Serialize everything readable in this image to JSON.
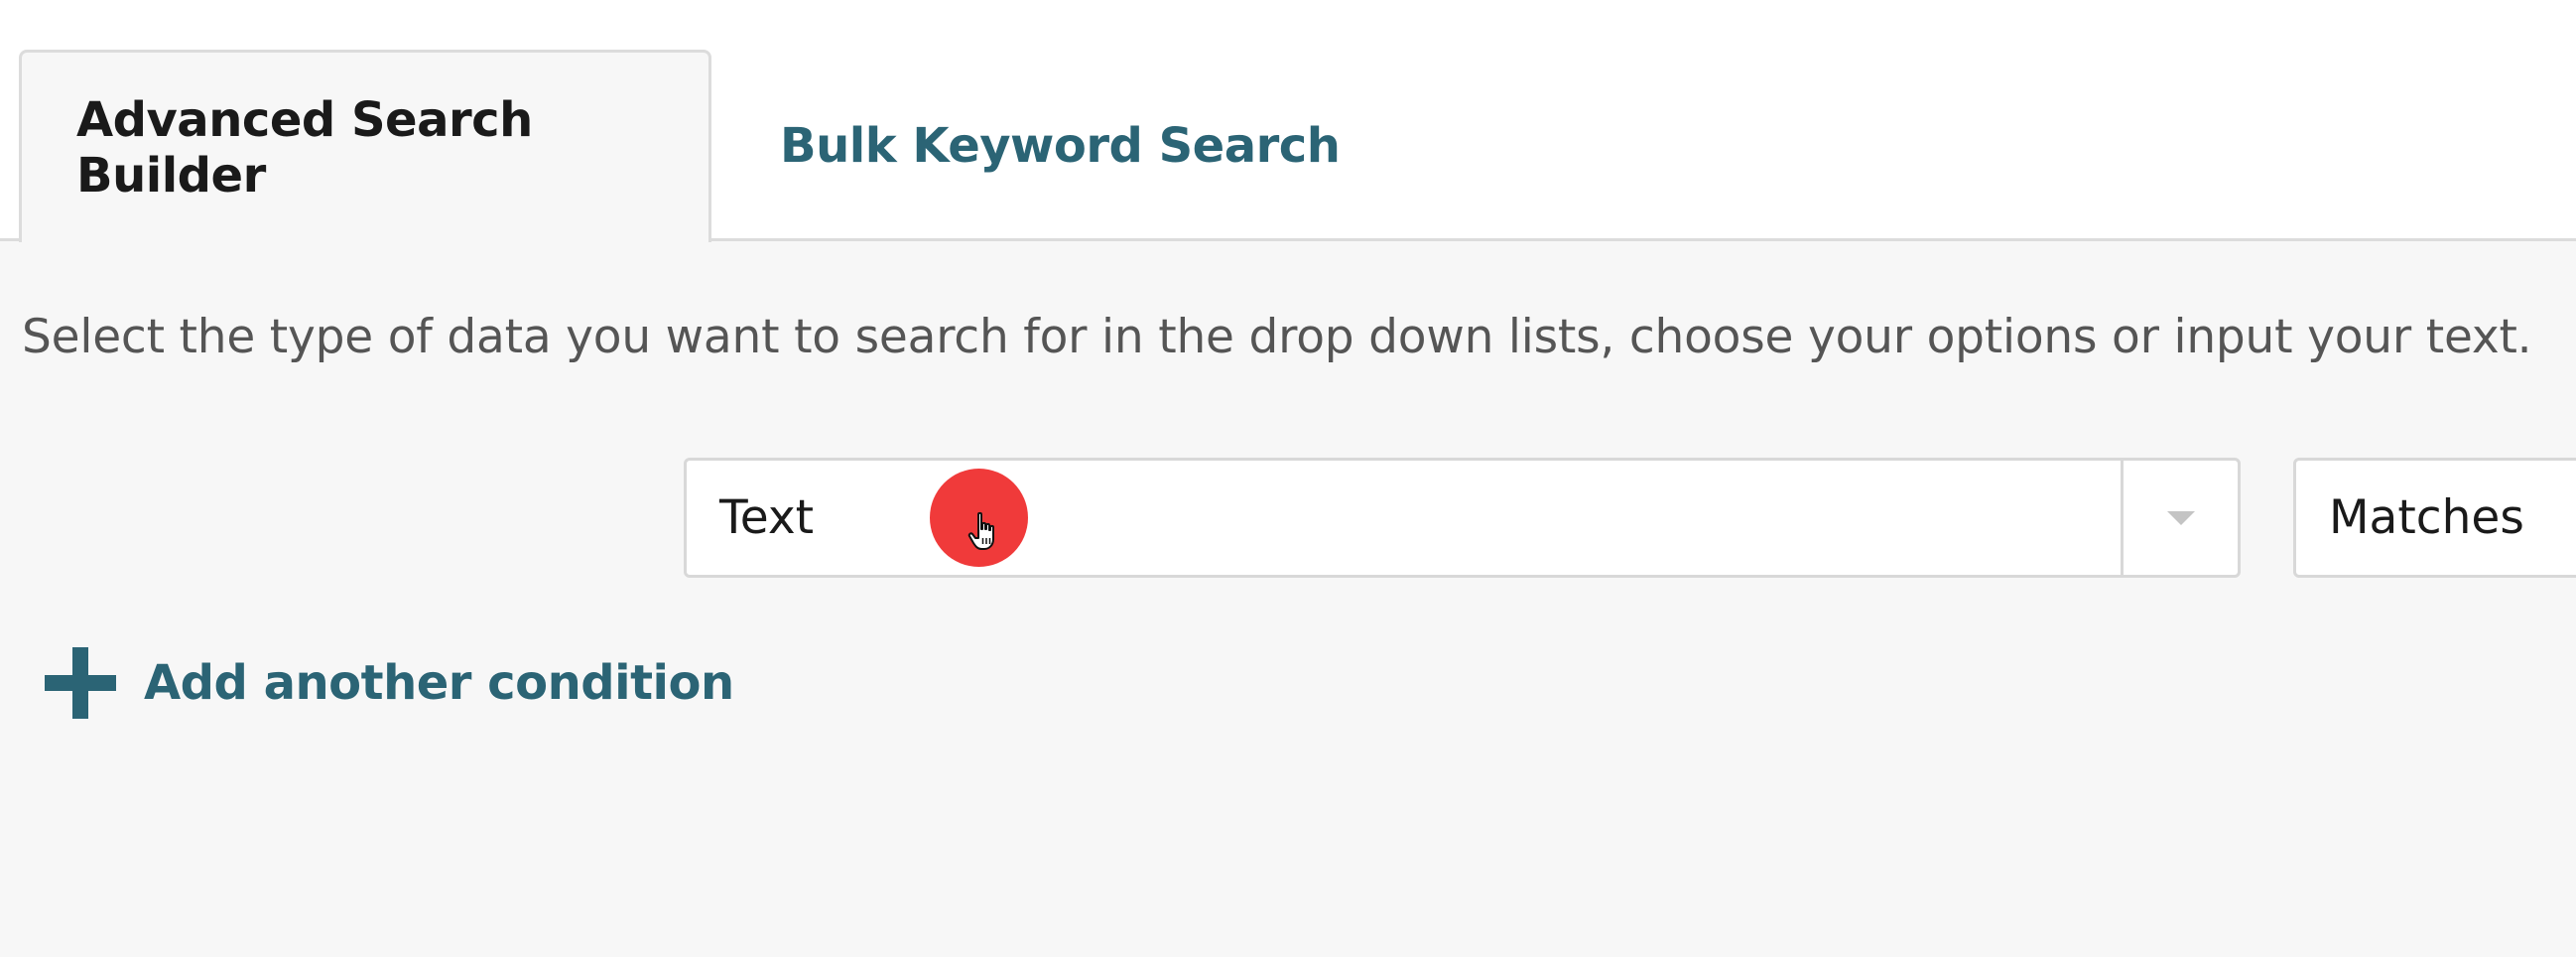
{
  "tabs": [
    {
      "label": "Advanced Search Builder",
      "active": true
    },
    {
      "label": "Bulk Keyword Search",
      "active": false
    }
  ],
  "instructions": "Select the type of data you want to search for in the drop down lists, choose your options or input your text.",
  "condition": {
    "field_select": {
      "value": "Text"
    },
    "operator_select": {
      "value": "Matches"
    }
  },
  "add_condition": {
    "label": "Add another condition",
    "icon": "plus-icon"
  },
  "colors": {
    "accent": "#2b6475",
    "click_indicator": "#f03a3a",
    "panel_background": "#f7f7f7"
  }
}
